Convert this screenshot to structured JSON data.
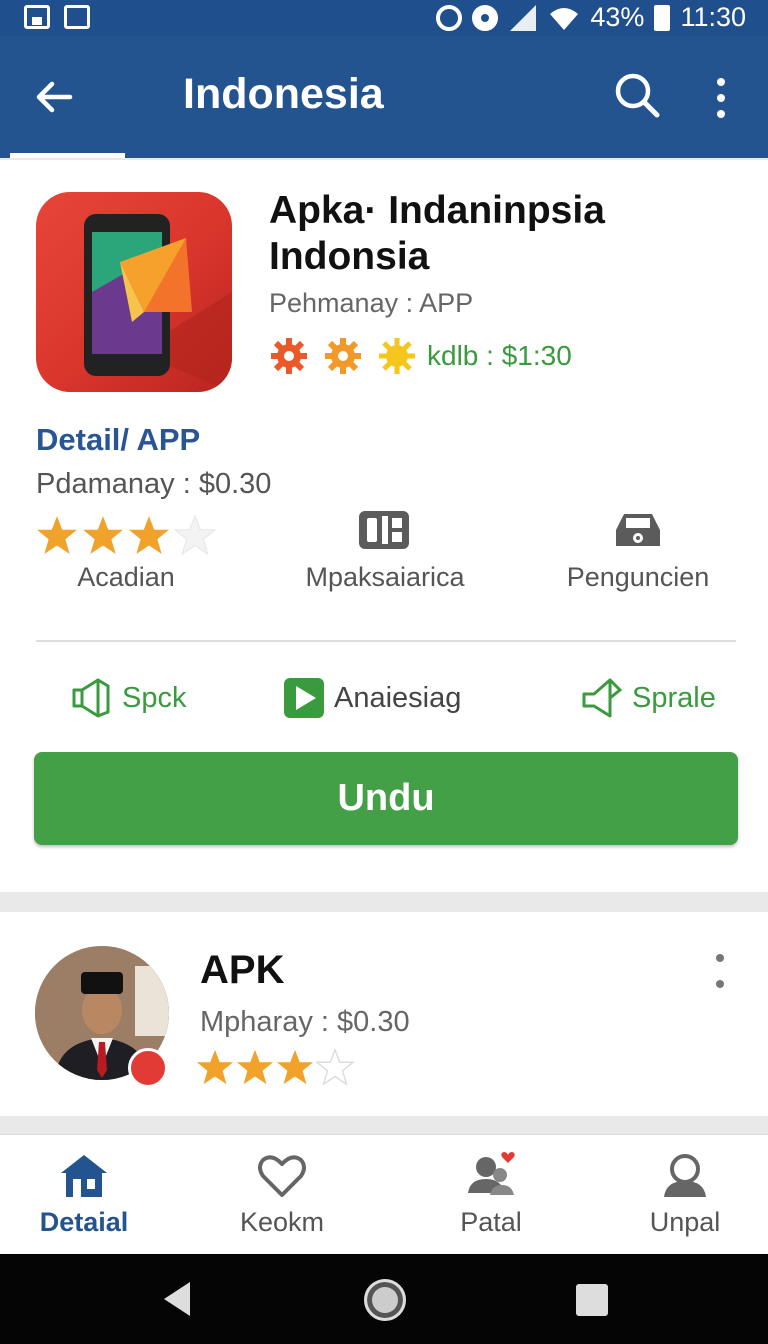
{
  "status_bar": {
    "battery": "43%",
    "time": "11:30"
  },
  "app_bar": {
    "title": "Indonesia"
  },
  "app": {
    "name": "Apka· Indaninpsia Indonsia",
    "publisher": "Pehmanay : APP",
    "price_line": "kdlb : $1:30"
  },
  "detail": {
    "title": "Detail/ APP",
    "price": "Pdamanay : $0.30",
    "rating": 3,
    "rating_max": 4,
    "features": [
      {
        "label": "Acadian"
      },
      {
        "label": "Mpaksaiarica",
        "icon": "grid-icon"
      },
      {
        "label": "Penguncien",
        "icon": "car-icon"
      }
    ]
  },
  "actions": [
    {
      "label": "Spck",
      "icon": "speaker-icon"
    },
    {
      "label": "Anaiesiag",
      "icon": "play-icon"
    },
    {
      "label": "Sprale",
      "icon": "share-icon"
    }
  ],
  "download_label": "Undu",
  "list_item": {
    "title": "APK",
    "price": "Mpharay : $0.30",
    "rating": 3,
    "rating_max": 4
  },
  "bottom_nav": [
    {
      "label": "Detaial",
      "icon": "home-icon",
      "active": true
    },
    {
      "label": "Keokm",
      "icon": "heart-icon",
      "active": false
    },
    {
      "label": "Patal",
      "icon": "people-icon",
      "active": false
    },
    {
      "label": "Unpal",
      "icon": "user-icon",
      "active": false
    }
  ],
  "colors": {
    "primary": "#23548f",
    "accent_green": "#43a047",
    "star": "#f0a22a"
  }
}
